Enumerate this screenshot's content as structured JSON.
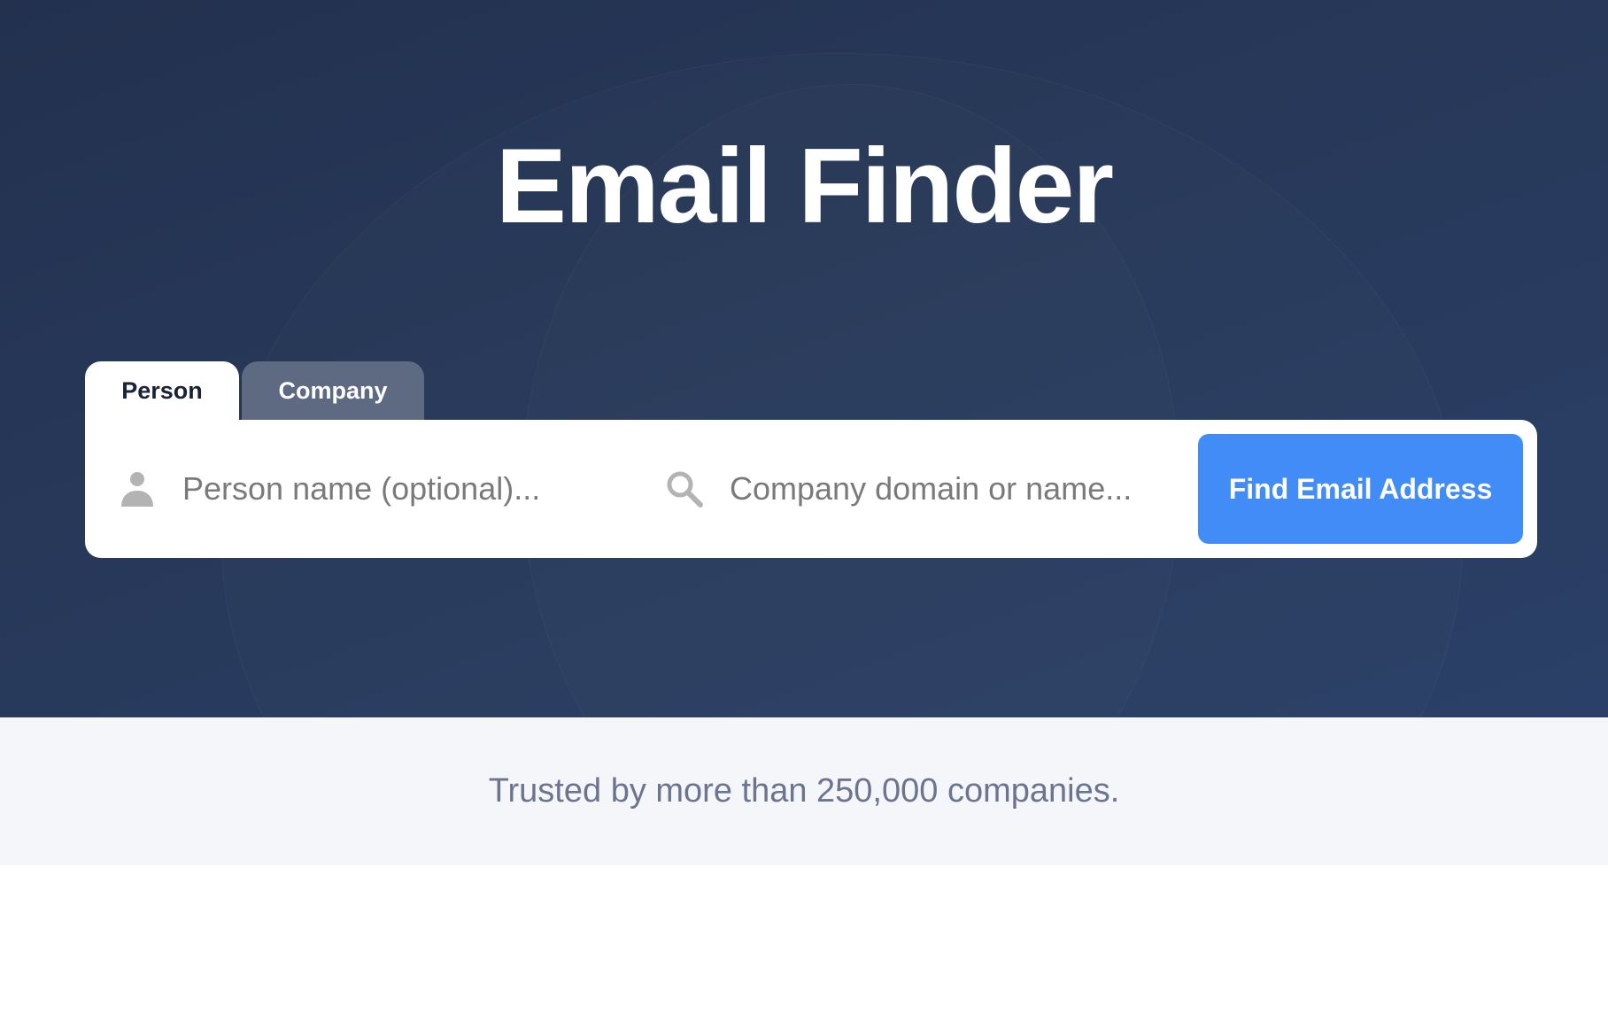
{
  "hero": {
    "title": "Email Finder"
  },
  "tabs": [
    {
      "label": "Person",
      "active": true
    },
    {
      "label": "Company",
      "active": false
    }
  ],
  "search": {
    "person_field": {
      "icon": "person-icon",
      "placeholder": "Person name (optional)...",
      "value": ""
    },
    "company_field": {
      "icon": "search-icon",
      "placeholder": "Company domain or name...",
      "value": ""
    },
    "submit_label": "Find Email Address"
  },
  "trust": {
    "text": "Trusted by more than 250,000 companies."
  },
  "colors": {
    "hero_background": "#263857",
    "accent": "#428cf8",
    "inactive_tab": "#5e6a82",
    "trust_band": "#f4f6fa",
    "trust_text": "#6c7490"
  }
}
